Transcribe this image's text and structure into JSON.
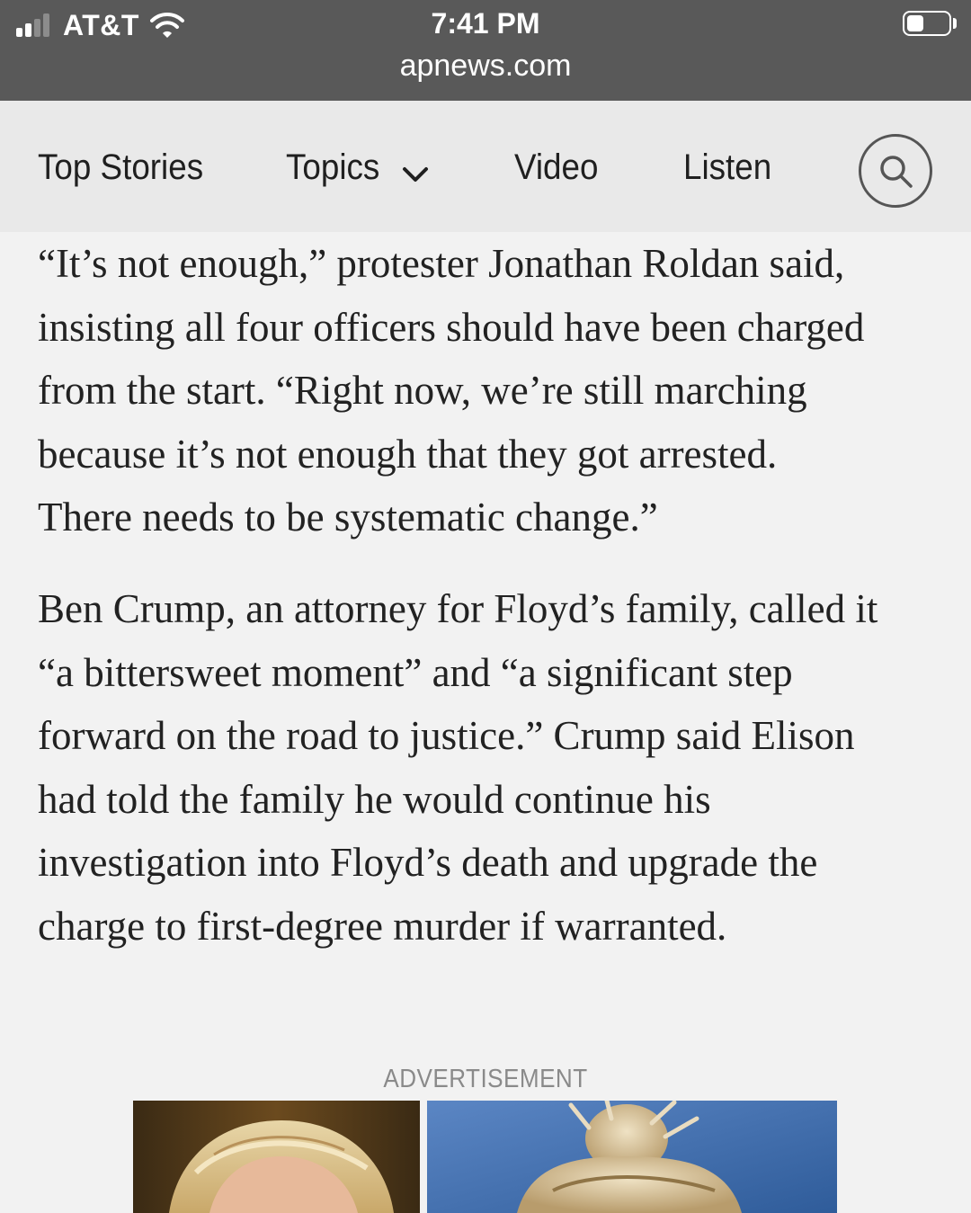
{
  "status_bar": {
    "carrier": "AT&T",
    "time": "7:41 PM",
    "url": "apnews.com",
    "signal_bars_active": 2,
    "signal_bars_total": 4,
    "battery_level": 0.4
  },
  "nav": {
    "top_stories": "Top Stories",
    "topics": "Topics",
    "video": "Video",
    "listen": "Listen"
  },
  "article": {
    "paragraph_1": [
      "“It’s not enough,” protester Jonathan Roldan said,",
      "insisting all four officers should have been charged",
      "from the start. “Right now, we’re still marching",
      "because it’s not enough that they got arrested.",
      "There needs to be systematic change.”"
    ],
    "paragraph_2": [
      "Ben Crump, an attorney for Floyd’s family, called it",
      "“a bittersweet moment” and “a significant step",
      "forward on the road to justice.” Crump said Elison",
      "had told the family he would continue his",
      "investigation into Floyd’s death and upgrade the",
      "charge to first-degree murder if warranted."
    ]
  },
  "advertisement": {
    "label": "ADVERTISEMENT"
  },
  "colors": {
    "status_bar_bg": "#595959",
    "nav_bg": "#e9e9e9",
    "page_bg": "#f2f2f2",
    "text": "#222222"
  }
}
